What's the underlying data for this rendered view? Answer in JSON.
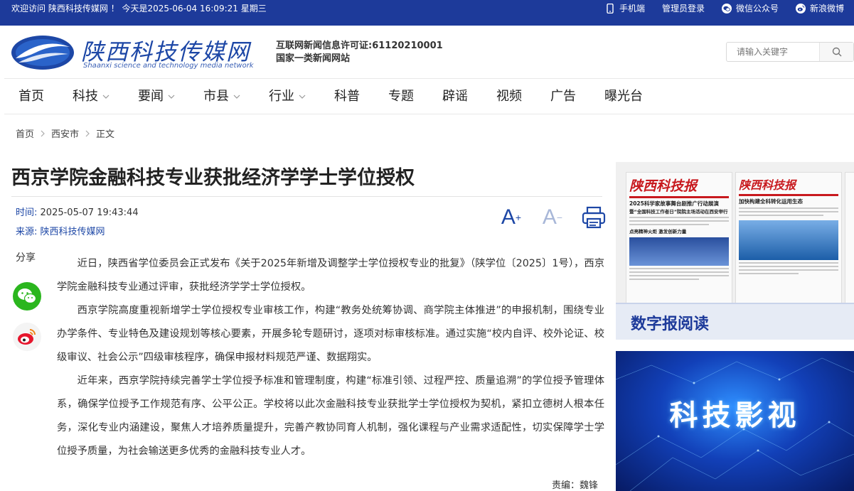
{
  "topbar": {
    "welcome": "欢迎访问 陕西科技传媒网 ！ 今天是2025-06-04 16:09:21 星期三",
    "links": [
      {
        "label": "手机端",
        "icon": "mobile-icon"
      },
      {
        "label": "管理员登录",
        "icon": ""
      },
      {
        "label": "微信公众号",
        "icon": "wechat-icon"
      },
      {
        "label": "新浪微博",
        "icon": "weibo-icon"
      }
    ]
  },
  "header": {
    "logo_cn": "陕西科技传媒网",
    "logo_en": "Shaanxi science and technology media network",
    "license_line1": "互联网新闻信息许可证:61120210001",
    "license_line2": "国家一类新闻网站",
    "search_placeholder": "请输入关键字"
  },
  "nav": [
    {
      "label": "首页",
      "dropdown": false
    },
    {
      "label": "科技",
      "dropdown": true
    },
    {
      "label": "要闻",
      "dropdown": true
    },
    {
      "label": "市县",
      "dropdown": true
    },
    {
      "label": "行业",
      "dropdown": true
    },
    {
      "label": "科普",
      "dropdown": false
    },
    {
      "label": "专题",
      "dropdown": false
    },
    {
      "label": "辟谣",
      "dropdown": false
    },
    {
      "label": "视频",
      "dropdown": false
    },
    {
      "label": "广告",
      "dropdown": false
    },
    {
      "label": "曝光台",
      "dropdown": false
    }
  ],
  "breadcrumb": [
    "首页",
    "西安市",
    "正文"
  ],
  "article": {
    "title": "西京学院金融科技专业获批经济学学士学位授权",
    "time_label": "时间:",
    "time": "2025-05-07 19:43:44",
    "source_label": "来源:",
    "source": "陕西科技传媒网",
    "share_label": "分享",
    "paragraphs": [
      "近日，陕西省学位委员会正式发布《关于2025年新增及调整学士学位授权专业的批复》（陕学位〔2025〕1号），西京学院金融科技专业通过评审，获批经济学学士学位授权。",
      "西京学院高度重视新增学士学位授权专业审核工作，构建“教务处统筹协调、商学院主体推进”的申报机制，围绕专业办学条件、专业特色及建设规划等核心要素，开展多轮专题研讨，逐项对标审核标准。通过实施“校内自评、校外论证、校级审议、社会公示”四级审核程序，确保申报材料规范严谨、数据翔实。",
      "近年来，西京学院持续完善学士学位授予标准和管理制度，构建“标准引领、过程严控、质量追溯”的学位授予管理体系，确保学位授予工作规范有序、公平公正。学校将以此次金融科技专业获批学士学位授权为契机，紧扣立德树人根本任务，深化专业内涵建设，聚焦人才培养质量提升，完善产教协同育人机制，强化课程与产业需求适配性，切实保障学士学位授予质量，为社会输送更多优秀的金融科技专业人才。"
    ],
    "editor": "责编：魏锋"
  },
  "tools": {
    "font_up": "A",
    "font_down": "A"
  },
  "sidebar": {
    "paper1": {
      "masthead": "陕西科技报",
      "headline1": "2025科学家故事舞台剧推广行动展演",
      "headline2": "暨“全国科技工作者日”院院主场活动在西安举行",
      "headline3": "点亮精神火炬 激发创新力量"
    },
    "paper2": {
      "masthead": "陕西科技报",
      "headline1": "加快构建全科转化运用生态"
    },
    "digital_title": "数字报阅读",
    "video_title": "科技影视"
  }
}
